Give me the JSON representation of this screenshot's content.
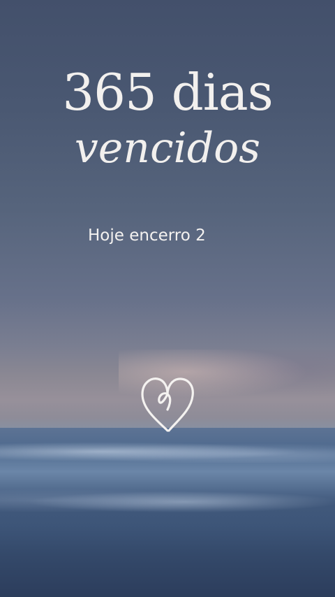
{
  "hero": {
    "title": "365 dias",
    "subtitle": "vencidos",
    "caption": "Hoje encerro 2"
  },
  "icons": {
    "heart": "heart-icon"
  },
  "colors": {
    "text": "#f2f0ee",
    "sky": "#4a5872",
    "sea": "#3d5578"
  }
}
